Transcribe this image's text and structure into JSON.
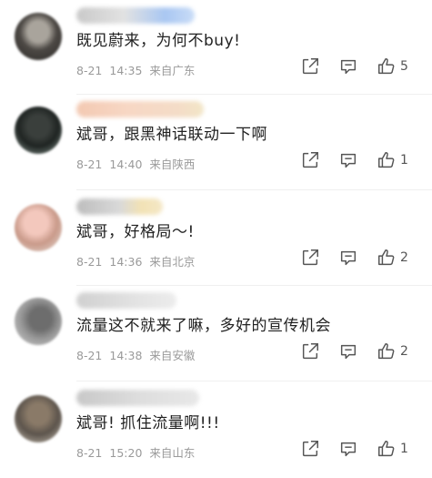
{
  "comments": [
    {
      "text": "既见蔚来，为何不buy!",
      "date": "8-21",
      "time": "14:35",
      "location": "来自广东",
      "likes": "5"
    },
    {
      "text": "斌哥，跟黑神话联动一下啊",
      "date": "8-21",
      "time": "14:40",
      "location": "来自陕西",
      "likes": "1"
    },
    {
      "text": "斌哥，好格局～!",
      "date": "8-21",
      "time": "14:36",
      "location": "来自北京",
      "likes": "2"
    },
    {
      "text": "流量这不就来了嘛，多好的宣传机会",
      "date": "8-21",
      "time": "14:38",
      "location": "来自安徽",
      "likes": "2"
    },
    {
      "text": "斌哥! 抓住流量啊!!!",
      "date": "8-21",
      "time": "15:20",
      "location": "来自山东",
      "likes": "1"
    }
  ],
  "icons": {
    "share": "share-icon",
    "reply": "comment-icon",
    "like": "thumbs-up-icon"
  },
  "colors": {
    "text": "#222222",
    "meta": "#9a9a9a",
    "icon": "#555555"
  }
}
